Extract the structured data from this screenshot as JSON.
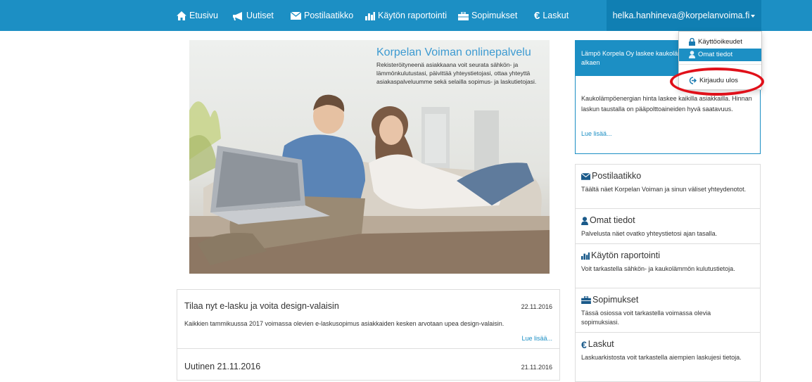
{
  "nav": {
    "items": [
      {
        "label": "Etusivu",
        "icon": "home-icon"
      },
      {
        "label": "Uutiset",
        "icon": "bullhorn-icon"
      },
      {
        "label": "Postilaatikko",
        "icon": "envelope-icon"
      },
      {
        "label": "Käytön raportointi",
        "icon": "bar-chart-icon"
      },
      {
        "label": "Sopimukset",
        "icon": "briefcase-icon"
      },
      {
        "label": "Laskut",
        "icon": "euro-icon"
      }
    ],
    "user_email": "helka.hanhineva@korpelanvoima.fi"
  },
  "user_dropdown": {
    "items": [
      {
        "label": "Käyttöoikeudet",
        "icon": "lock-icon"
      },
      {
        "label": "Omat tiedot",
        "icon": "user-icon"
      },
      {
        "label": "Kirjaudu ulos",
        "icon": "log-out-icon"
      }
    ]
  },
  "hero": {
    "title": "Korpelan Voiman onlinepalvelu",
    "body": "Rekisteröityneenä asiakkaana voit seurata sähkön- ja lämmönkulutustasi, päivittää yhteystietojasi, ottaa yhteyttä asiakaspalveluumme sekä selailla sopimus- ja laskutietojasi."
  },
  "notice": {
    "heading": "Lämpö Korpela Oy laskee kaukolämmön hintaa 1.12.2016 alkaen",
    "body": "Kaukolämpöenergian hinta laskee kaikilla asiakkailla. Hinnan laskun taustalla on pääpolttoaineiden hyvä saatavuus.",
    "link": "Lue lisää..."
  },
  "services": [
    {
      "title": "Postilaatikko",
      "icon": "envelope-icon",
      "desc": "Täältä näet Korpelan Voiman ja sinun väliset yhteydenotot."
    },
    {
      "title": "Omat tiedot",
      "icon": "user-icon",
      "desc": "Palvelusta näet ovatko yhteystietosi ajan tasalla."
    },
    {
      "title": "Käytön raportointi",
      "icon": "bar-chart-icon",
      "desc": "Voit tarkastella sähkön- ja kaukolämmön kulutustietoja."
    },
    {
      "title": "Sopimukset",
      "icon": "briefcase-icon",
      "desc": "Tässä osiossa voit tarkastella voimassa olevia sopimuksiasi."
    },
    {
      "title": "Laskut",
      "icon": "euro-icon",
      "desc": "Laskuarkistosta voit tarkastella aiempien laskujesi tietoja."
    }
  ],
  "news": [
    {
      "title": "Tilaa nyt e-lasku ja voita design-valaisin",
      "date": "22.11.2016",
      "excerpt": "Kaikkien tammikuussa 2017 voimassa olevien e-laskusopimus asiakkaiden kesken arvotaan  upea design-valaisin.",
      "link": "Lue lisää..."
    },
    {
      "title": "Uutinen 21.11.2016",
      "date": "21.11.2016"
    }
  ],
  "colors": {
    "nav_blue": "#1c8fc4",
    "highlight_red": "#e0101a"
  }
}
